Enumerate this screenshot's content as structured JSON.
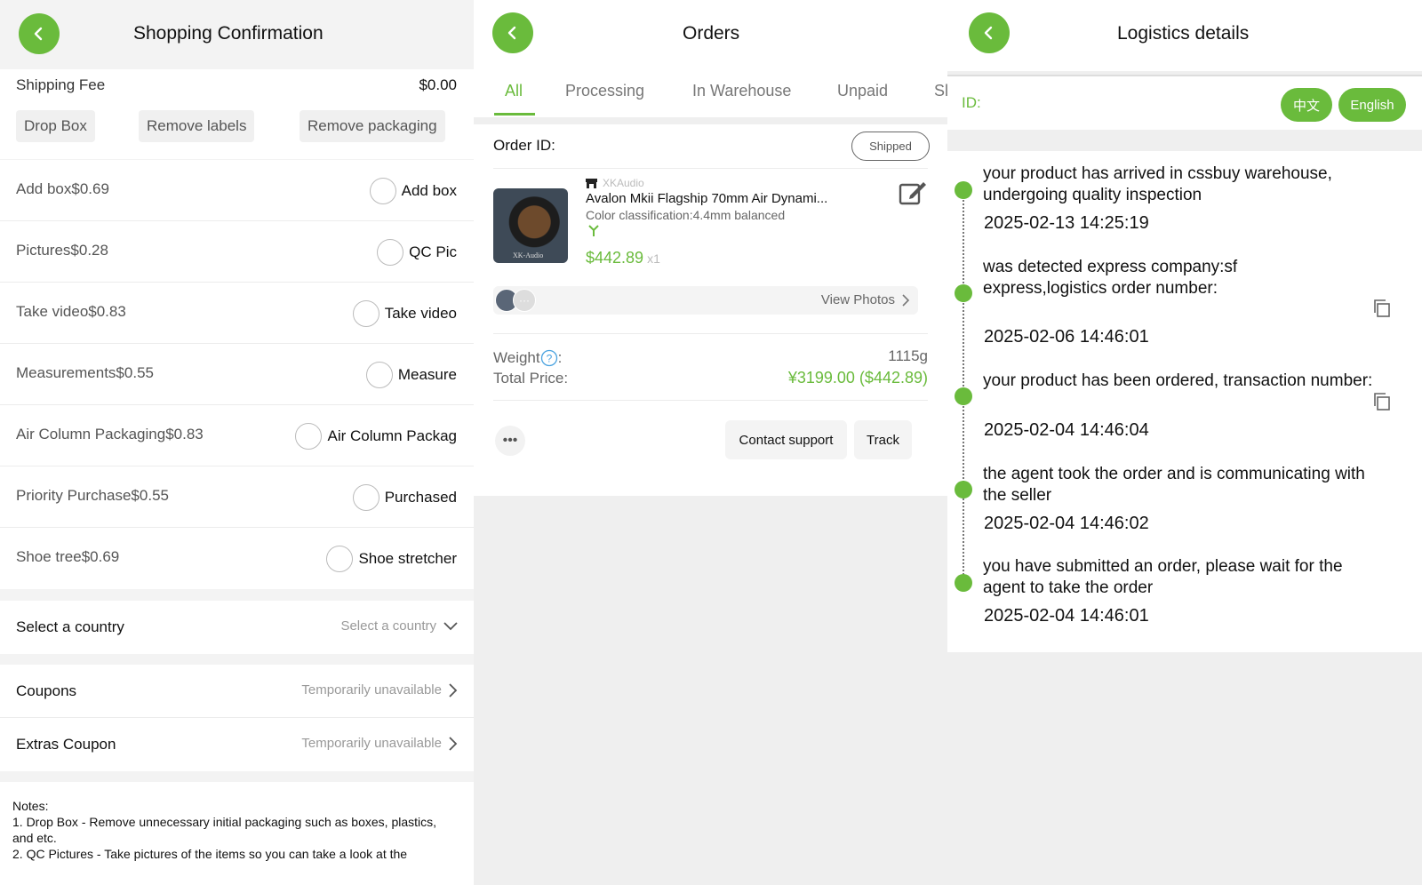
{
  "shopping_confirmation": {
    "title": "Shopping Confirmation",
    "shipping_fee_label": "Shipping Fee",
    "shipping_fee_value": "$0.00",
    "chips": [
      "Drop Box",
      "Remove labels",
      "Remove packaging"
    ],
    "services": [
      {
        "label": "Add box$0.69",
        "option": "Add box"
      },
      {
        "label": "Pictures$0.28",
        "option": "QC Pic"
      },
      {
        "label": "Take video$0.83",
        "option": "Take video"
      },
      {
        "label": "Measurements$0.55",
        "option": "Measure"
      },
      {
        "label": "Air Column Packaging$0.83",
        "option": "Air Column Packag"
      },
      {
        "label": "Priority Purchase$0.55",
        "option": "Purchased"
      },
      {
        "label": "Shoe tree$0.69",
        "option": "Shoe stretcher"
      }
    ],
    "country": {
      "label": "Select a country",
      "placeholder": "Select a country"
    },
    "coupons": {
      "label": "Coupons",
      "status": "Temporarily unavailable"
    },
    "extras_coupon": {
      "label": "Extras Coupon",
      "status": "Temporarily unavailable"
    },
    "notes": [
      "Notes:",
      "1. Drop Box - Remove unnecessary initial packaging such as boxes, plastics, and etc.",
      "2. QC Pictures - Take pictures of the items so you can take a look at the"
    ]
  },
  "orders": {
    "title": "Orders",
    "tabs": [
      "All",
      "Processing",
      "In Warehouse",
      "Unpaid",
      "Sl"
    ],
    "order_id_label": "Order ID:",
    "status_badge": "Shipped",
    "store_name": "XKAudio",
    "product_name": "Avalon Mkii Flagship 70mm Air Dynami...",
    "variant": "Color classification:4.4mm balanced",
    "price": "$442.89",
    "quantity": "x1",
    "image_caption": "XK-Audio",
    "view_photos": "View Photos",
    "weight_label": "Weight",
    "weight_value": "1115g",
    "total_label": "Total Price:",
    "total_value": "¥3199.00 ($442.89)",
    "contact_support": "Contact support",
    "track": "Track"
  },
  "logistics": {
    "title": "Logistics details",
    "id_label": "ID:",
    "lang_zh": "中文",
    "lang_en": "English",
    "events": [
      {
        "text": "your product has arrived in cssbuy warehouse, undergoing quality inspection",
        "time": "2025-02-13 14:25:19"
      },
      {
        "text": "was detected express company:sf express,logistics order number:",
        "time": "2025-02-06 14:46:01"
      },
      {
        "text": "your product has been ordered, transaction number:",
        "time": "2025-02-04 14:46:04"
      },
      {
        "text": "the agent took the order and is communicating with the seller",
        "time": "2025-02-04 14:46:02"
      },
      {
        "text": "you have submitted an order, please wait for the agent to take the order",
        "time": "2025-02-04 14:46:01"
      }
    ]
  },
  "colors": {
    "accent": "#6abb3c"
  }
}
